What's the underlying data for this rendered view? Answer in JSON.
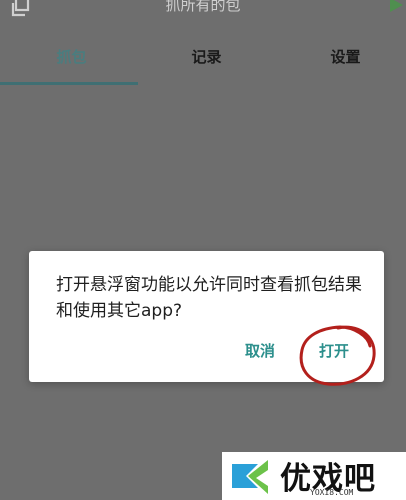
{
  "header": {
    "title": "抓所有的包"
  },
  "tabs": [
    {
      "label": "抓包",
      "active": true
    },
    {
      "label": "记录",
      "active": false
    },
    {
      "label": "设置",
      "active": false
    }
  ],
  "dialog": {
    "message": "打开悬浮窗功能以允许同时查看抓包结果和使用其它app?",
    "cancel_label": "取消",
    "confirm_label": "打开"
  },
  "watermark": {
    "brand": "优戏吧",
    "url": "YOXI8.COM"
  },
  "colors": {
    "overlay": "#6e6e6e",
    "accent": "#2c8f8c",
    "tab_indicator": "#3f6f73",
    "annotation_red": "#b3201c"
  },
  "icons": {
    "top_left": "copy-icon",
    "top_right": "play-icon"
  }
}
